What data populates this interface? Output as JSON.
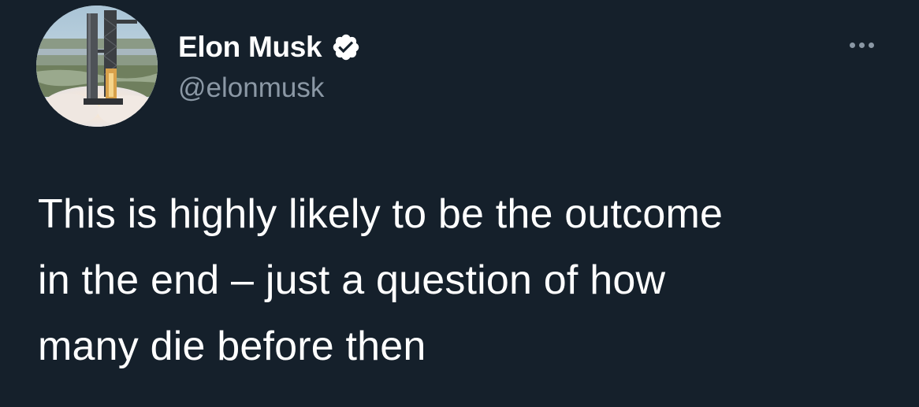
{
  "author": {
    "display_name": "Elon Musk",
    "handle": "@elonmusk",
    "verified": true,
    "avatar_icon": "rocket-launch-tower-avatar"
  },
  "menu": {
    "icon": "more-options-icon"
  },
  "tweet": {
    "lines": [
      "This is highly likely to be the outcome",
      "in the end – just a question of how",
      "many die before then"
    ]
  },
  "colors": {
    "background": "#15202b",
    "text_primary": "#ffffff",
    "text_secondary": "#8b98a5"
  }
}
